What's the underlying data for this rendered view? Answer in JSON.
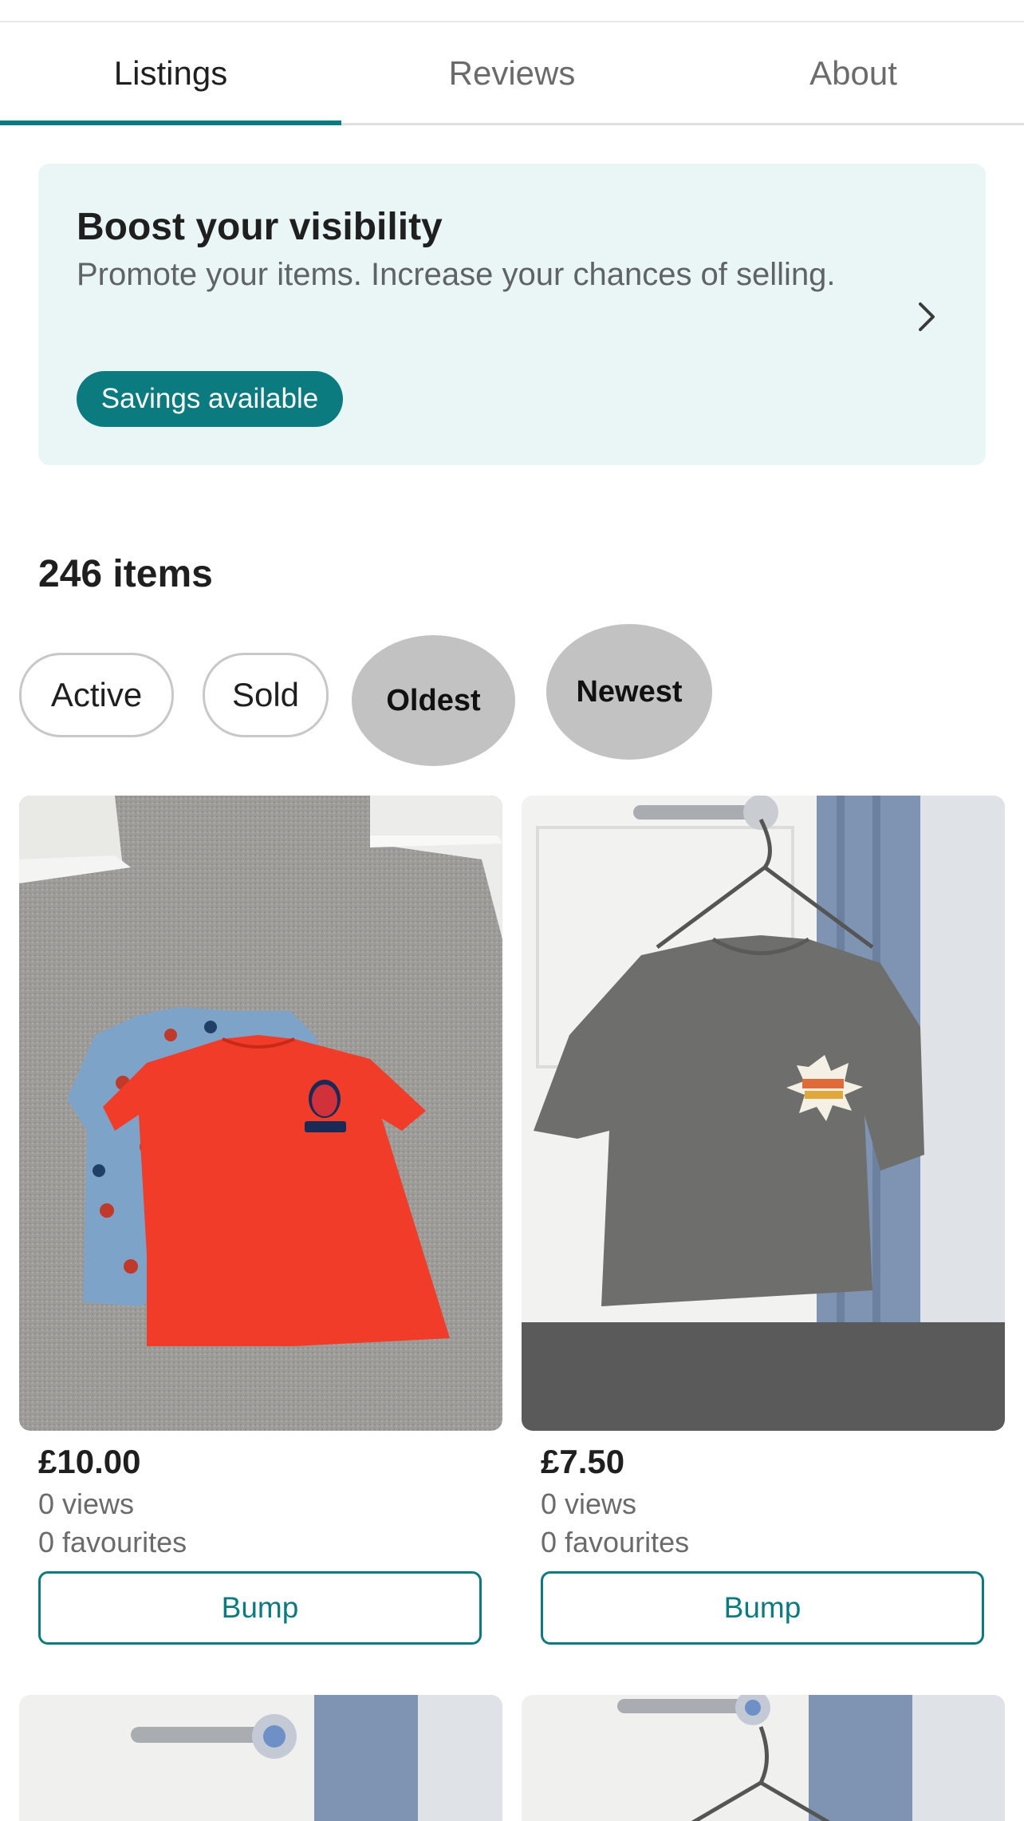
{
  "tabs": [
    {
      "label": "Listings",
      "active": true
    },
    {
      "label": "Reviews",
      "active": false
    },
    {
      "label": "About",
      "active": false
    }
  ],
  "promo": {
    "title": "Boost your visibility",
    "description": "Promote your items. Increase your chances of selling.",
    "badge": "Savings available"
  },
  "items_count": "246 items",
  "filters": {
    "active": "Active",
    "sold": "Sold",
    "oldest": "Oldest",
    "newest": "Newest"
  },
  "products": [
    {
      "price": "£10.00",
      "views": "0 views",
      "favourites": "0 favourites",
      "bump": "Bump"
    },
    {
      "price": "£7.50",
      "views": "0 views",
      "favourites": "0 favourites",
      "bump": "Bump"
    }
  ],
  "colors": {
    "accent": "#0b7b7f",
    "promo_bg": "#eaf6f6",
    "chip_grey": "#c2c2c2"
  }
}
